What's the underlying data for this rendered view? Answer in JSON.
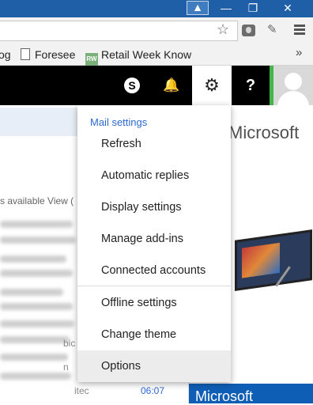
{
  "browser": {
    "bookmarks": [
      {
        "label": "og"
      },
      {
        "label": "Foresee",
        "icon": "document-icon"
      },
      {
        "label": "Retail Week Know",
        "icon": "rw-icon",
        "icon_text": "RW"
      }
    ],
    "more_bookmarks": "»"
  },
  "outlook_bar": {
    "skype_letter": "S"
  },
  "settings_menu": {
    "header": "Mail settings",
    "items": [
      {
        "label": "Refresh"
      },
      {
        "label": "Automatic replies"
      },
      {
        "label": "Display settings"
      },
      {
        "label": "Manage add-ins"
      },
      {
        "label": "Connected accounts"
      },
      {
        "label": "Offline settings"
      },
      {
        "label": "Change theme"
      },
      {
        "label": "Options"
      }
    ]
  },
  "message_list": {
    "available_text": "s available View (",
    "peek_texts": [
      "bic",
      "n"
    ],
    "last_time_peek": "itec",
    "last_time": "06:07"
  },
  "ad": {
    "brand": "Microsoft",
    "footer_text": "Microsoft"
  },
  "colors": {
    "accent": "#2b6ad1",
    "titlebar": "#1f5fa8",
    "avatar_border": "#43b54a"
  }
}
